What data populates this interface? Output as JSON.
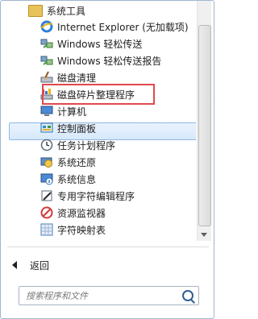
{
  "folder": {
    "label": "系统工具",
    "icon": "folder-icon"
  },
  "items": [
    {
      "label": "Internet Explorer (无加载项)",
      "icon": "internet-explorer-icon",
      "color": "#2d7fd6"
    },
    {
      "label": "Windows 轻松传送",
      "icon": "easy-transfer-icon",
      "color": "#3c9a3c"
    },
    {
      "label": "Windows 轻松传送报告",
      "icon": "easy-transfer-report-icon",
      "color": "#3c9a3c"
    },
    {
      "label": "磁盘清理",
      "icon": "disk-cleanup-icon",
      "color": "#6d7b8c"
    },
    {
      "label": "磁盘碎片整理程序",
      "icon": "disk-defragmenter-icon",
      "color": "#3a6fc4"
    },
    {
      "label": "计算机",
      "icon": "computer-icon",
      "color": "#3d7bc4"
    },
    {
      "label": "控制面板",
      "icon": "control-panel-icon",
      "color": "#2a8fd0"
    },
    {
      "label": "任务计划程序",
      "icon": "task-scheduler-icon",
      "color": "#6b7d91"
    },
    {
      "label": "系统还原",
      "icon": "system-restore-icon",
      "color": "#2f6fbf"
    },
    {
      "label": "系统信息",
      "icon": "system-info-icon",
      "color": "#4a7fb8"
    },
    {
      "label": "专用字符编辑程序",
      "icon": "private-char-editor-icon",
      "color": "#5b6a78"
    },
    {
      "label": "资源监视器",
      "icon": "resource-monitor-icon",
      "color": "#d23b3b"
    },
    {
      "label": "字符映射表",
      "icon": "character-map-icon",
      "color": "#4a7fb8"
    }
  ],
  "selected_index": 6,
  "back": {
    "label": "返回"
  },
  "search": {
    "placeholder": "搜索程序和文件"
  },
  "colors": {
    "highlight_border": "#8fb7e6",
    "annotation_box": "#e0484d"
  }
}
